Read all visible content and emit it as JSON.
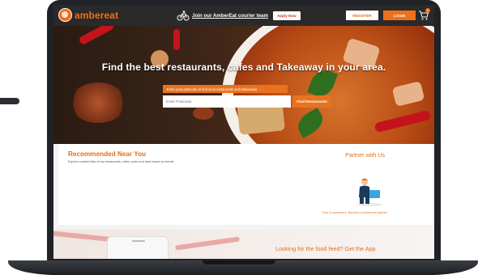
{
  "brand": {
    "name": "ambereat",
    "color": "#f06f1a"
  },
  "navbar": {
    "courier_text": "Join our AmberEat courier team",
    "apply_label": "Apply Now",
    "register_label": "REGISTER",
    "login_label": "LOGIN",
    "cart_count": "0"
  },
  "hero": {
    "title": "Find the best restaurants, cafes and Takeaway in your area.",
    "hint": "Enter your postcode to find local restaurants and takeaways",
    "postcode_placeholder": "Enter Postcode",
    "find_label": "Find Restaurants"
  },
  "recommended": {
    "title": "Recommended Near You",
    "subtitle": "Explore curated lists of top restaurants, cafes, pubs and bars based on trends"
  },
  "partner": {
    "title": "Partner with Us",
    "subtitle": "Find & customers. Become a restaurant partner"
  },
  "app_section": {
    "title": "Looking for the food feed? Get the App"
  },
  "colors": {
    "accent": "#e8731f",
    "nav_bg": "#2a2a2a"
  }
}
